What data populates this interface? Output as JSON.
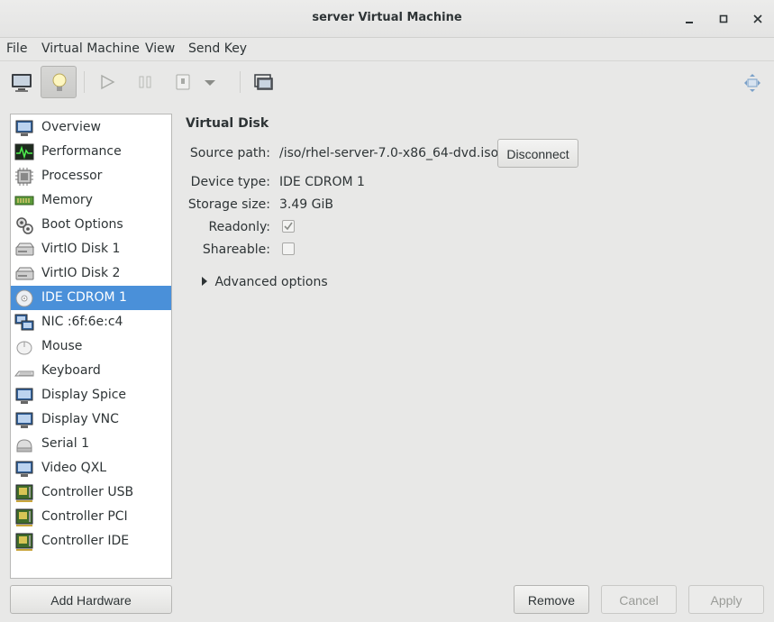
{
  "window": {
    "title": "server Virtual Machine",
    "minimize": "–",
    "maximize": "□",
    "close": "✕"
  },
  "menubar": [
    "File",
    "Virtual Machine",
    "View",
    "Send Key"
  ],
  "sidebar": {
    "items": [
      {
        "label": "Overview",
        "icon": "overview-icon"
      },
      {
        "label": "Performance",
        "icon": "performance-icon"
      },
      {
        "label": "Processor",
        "icon": "processor-icon"
      },
      {
        "label": "Memory",
        "icon": "memory-icon"
      },
      {
        "label": "Boot Options",
        "icon": "boot-options-icon"
      },
      {
        "label": "VirtIO Disk 1",
        "icon": "disk-icon"
      },
      {
        "label": "VirtIO Disk 2",
        "icon": "disk-icon"
      },
      {
        "label": "IDE CDROM 1",
        "icon": "cdrom-icon",
        "selected": true
      },
      {
        "label": "NIC :6f:6e:c4",
        "icon": "nic-icon"
      },
      {
        "label": "Mouse",
        "icon": "mouse-icon"
      },
      {
        "label": "Keyboard",
        "icon": "keyboard-icon"
      },
      {
        "label": "Display Spice",
        "icon": "display-icon"
      },
      {
        "label": "Display VNC",
        "icon": "display-icon"
      },
      {
        "label": "Serial 1",
        "icon": "serial-icon"
      },
      {
        "label": "Video QXL",
        "icon": "video-icon"
      },
      {
        "label": "Controller USB",
        "icon": "controller-icon"
      },
      {
        "label": "Controller PCI",
        "icon": "controller-icon"
      },
      {
        "label": "Controller IDE",
        "icon": "controller-icon"
      }
    ],
    "add_hardware": "Add Hardware"
  },
  "details": {
    "section_title": "Virtual Disk",
    "source_path_label": "Source path:",
    "source_path_value": "/iso/rhel-server-7.0-x86_64-dvd.iso",
    "disconnect_label": "Disconnect",
    "device_type_label": "Device type:",
    "device_type_value": "IDE CDROM 1",
    "storage_size_label": "Storage size:",
    "storage_size_value": "3.49 GiB",
    "readonly_label": "Readonly:",
    "readonly_checked": true,
    "shareable_label": "Shareable:",
    "shareable_checked": false,
    "advanced_label": "Advanced options"
  },
  "footer": {
    "remove": "Remove",
    "cancel": "Cancel",
    "apply": "Apply"
  },
  "colors": {
    "selection": "#4a90d9",
    "background": "#e8e8e7"
  }
}
